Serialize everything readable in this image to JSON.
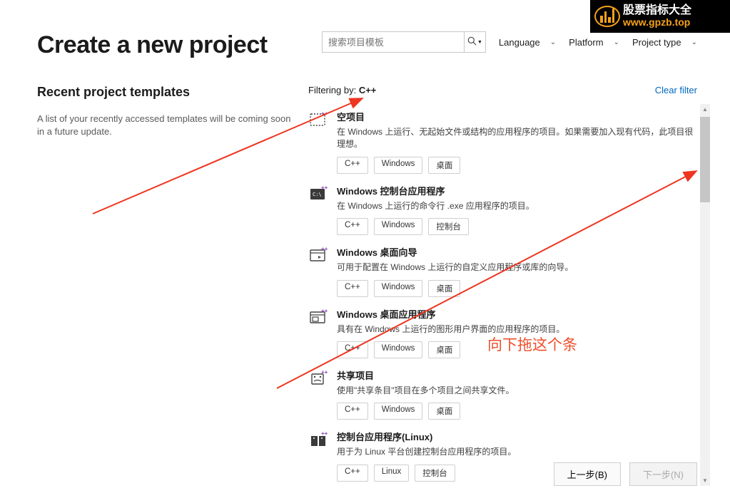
{
  "watermark": {
    "cn": "股票指标大全",
    "url": "www.gpzb.top"
  },
  "header": {
    "title": "Create a new project",
    "search_placeholder": "搜索项目模板",
    "dropdowns": {
      "language": "Language",
      "platform": "Platform",
      "project_type": "Project type"
    }
  },
  "recent": {
    "title": "Recent project templates",
    "desc": "A list of your recently accessed templates will be coming soon in a future update."
  },
  "filter": {
    "label": "Filtering by: ",
    "value": "C++",
    "clear": "Clear filter"
  },
  "templates": [
    {
      "title": "空项目",
      "desc": "在 Windows 上运行、无起始文件或结构的应用程序的项目。如果需要加入现有代码，此项目很理想。",
      "tags": [
        "C++",
        "Windows",
        "桌面"
      ]
    },
    {
      "title": "Windows 控制台应用程序",
      "desc": "在 Windows 上运行的命令行 .exe 应用程序的项目。",
      "tags": [
        "C++",
        "Windows",
        "控制台"
      ]
    },
    {
      "title": "Windows 桌面向导",
      "desc": "可用于配置在 Windows 上运行的自定义应用程序或库的向导。",
      "tags": [
        "C++",
        "Windows",
        "桌面"
      ]
    },
    {
      "title": "Windows 桌面应用程序",
      "desc": "具有在 Windows 上运行的图形用户界面的应用程序的项目。",
      "tags": [
        "C++",
        "Windows",
        "桌面"
      ]
    },
    {
      "title": "共享项目",
      "desc": "使用\"共享条目\"项目在多个项目之间共享文件。",
      "tags": [
        "C++",
        "Windows",
        "桌面"
      ]
    },
    {
      "title": "控制台应用程序(Linux)",
      "desc": "用于为 Linux 平台创建控制台应用程序的项目。",
      "tags": [
        "C++",
        "Linux",
        "控制台"
      ]
    }
  ],
  "footer": {
    "back": "上一步(B)",
    "next": "下一步(N)"
  },
  "annotation": {
    "drag_hint": "向下拖这个条"
  }
}
